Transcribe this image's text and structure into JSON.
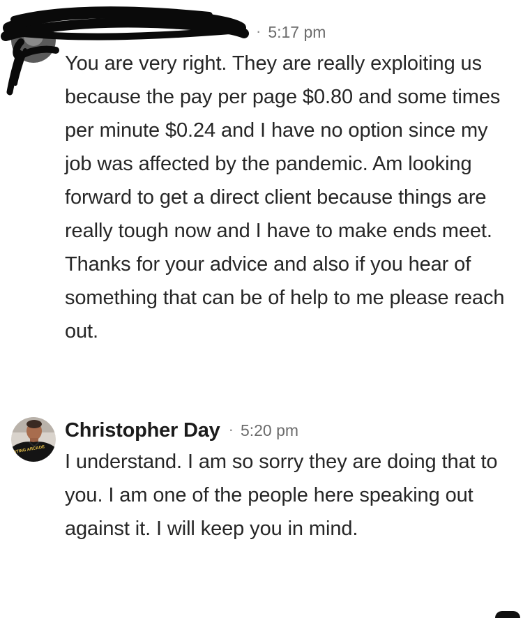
{
  "messages": [
    {
      "author": "",
      "separator": "·",
      "time": "5:17 pm",
      "text": "You are very right. They are really exploiting us because the pay per page $0.80 and some times per minute $0.24 and I have no option since my job was affected by the pandemic. Am looking forward to get a direct client because things are really tough now and I have to make ends meet. Thanks for your advice and also if you hear of something that can be of help to me please reach out.",
      "author_redacted": true
    },
    {
      "author": "Christopher Day",
      "separator": "·",
      "time": "5:20 pm",
      "text": "I understand. I am so sorry they are doing that to you. I am one of the people here speaking out against it. I will keep you in mind.",
      "avatar": {
        "shirt_text": "STING ARCADE"
      }
    }
  ],
  "colors": {
    "author": "#1b1b1b",
    "body": "#262626",
    "time": "#6b6b6b",
    "redaction": "#0a0a0a"
  }
}
